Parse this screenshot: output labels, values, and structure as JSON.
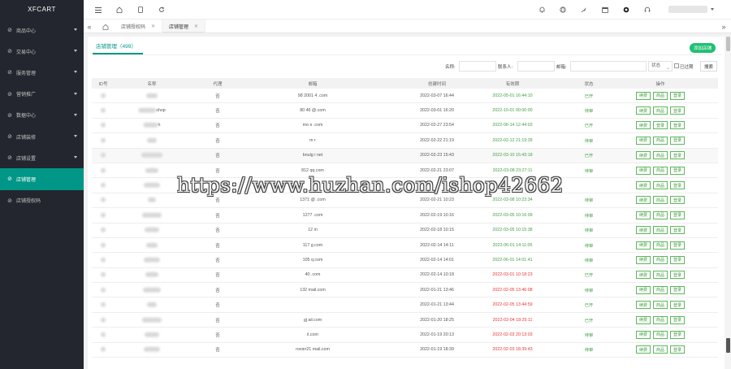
{
  "sidebar": {
    "brand": "XFCART",
    "items": [
      {
        "label": "商品中心",
        "icon": "grid-icon",
        "has_arrow": true
      },
      {
        "label": "交易中心",
        "icon": "cart-icon",
        "has_arrow": true
      },
      {
        "label": "服务管理",
        "icon": "briefcase-icon",
        "has_arrow": true
      },
      {
        "label": "营销推广",
        "icon": "megaphone-icon",
        "has_arrow": true
      },
      {
        "label": "数据中心",
        "icon": "chart-icon",
        "has_arrow": true
      },
      {
        "label": "店铺装修",
        "icon": "brush-icon",
        "has_arrow": true
      },
      {
        "label": "店铺设置",
        "icon": "gear-icon",
        "has_arrow": true
      },
      {
        "label": "店铺管理",
        "icon": "shop-icon",
        "has_arrow": false,
        "active": true
      },
      {
        "label": "店铺授权码",
        "icon": "key-icon",
        "has_arrow": false
      }
    ]
  },
  "header": {
    "icons": [
      "menu-icon",
      "home-icon",
      "mobile-icon",
      "refresh-icon"
    ],
    "right_icons": [
      "bell-icon",
      "globe-icon",
      "rocket-icon",
      "calendar-icon",
      "theme-icon",
      "headset-icon"
    ]
  },
  "tabs": [
    {
      "label": "店铺授权码",
      "active": false
    },
    {
      "label": "店铺管理",
      "active": true
    }
  ],
  "content": {
    "tab_label": "店铺管理（499）",
    "add_button": "添加店铺",
    "filters": {
      "name_label": "名称:",
      "contact_label": "联系人:",
      "email_label": "邮箱:",
      "status_placeholder": "状态",
      "expired_label": "已过期",
      "search_button": "搜索"
    }
  },
  "table": {
    "columns": [
      "ID号",
      "名称",
      "代理",
      "邮箱",
      "创建时间",
      "有效期",
      "状态",
      "操作"
    ],
    "ops": [
      "续费",
      "商品",
      "登录"
    ],
    "rows": [
      {
        "id": "",
        "name": "",
        "agent": "否",
        "email": "98  2001  4  .com",
        "created": "2022-03-07 16:44",
        "expire": "2022-05-01 16:44:10",
        "expire_color": "green",
        "status": "已开",
        "ops": [
          "续费",
          "商品",
          "登录"
        ]
      },
      {
        "id": "",
        "name": "shop",
        "agent": "否",
        "email": "80  46  @.com",
        "created": "2022-03-01 16:20",
        "expire": "2022-10-01 00:00:00",
        "expire_color": "green",
        "status": "待审",
        "ops": [
          "续费",
          "商品",
          "登录"
        ]
      },
      {
        "id": "",
        "name": "h",
        "agent": "否",
        "email": "mo  e  .com",
        "created": "2022-02-27 23:54",
        "expire": "2022-06-14 12:44:03",
        "expire_color": "green",
        "status": "已开",
        "ops": [
          "续费",
          "登录",
          "登录"
        ]
      },
      {
        "id": "",
        "name": "",
        "agent": "否",
        "email": "m  r",
        "created": "2022-02-22 21:19",
        "expire": "2022-02-12 21:19:39",
        "expire_color": "green",
        "status": "待审",
        "ops": [
          "续费",
          "商品",
          "登录"
        ]
      },
      {
        "id": "",
        "name": "",
        "agent": "否",
        "email": "bnulg  i  net",
        "created": "2022-02-23 15:43",
        "expire": "2022-03-10 15:43:18",
        "expire_color": "green",
        "status": "已开",
        "ops": [
          "续费",
          "商品",
          "登录"
        ]
      },
      {
        "id": "",
        "name": "",
        "agent": "否",
        "email": "812  qq.com",
        "created": "2022-02-21 23:07",
        "expire": "2022-03-08 23:27:11",
        "expire_color": "green",
        "status": "待审",
        "ops": [
          "续费",
          "商品",
          "登录"
        ]
      },
      {
        "id": "",
        "name": "",
        "agent": "否",
        "email": "",
        "created": "",
        "expire": "",
        "expire_color": "green",
        "status": "",
        "ops": [
          "续费",
          "商品",
          "登录"
        ]
      },
      {
        "id": "",
        "name": "",
        "agent": "否",
        "email": "1371  @  .com",
        "created": "2022-02-21 10:23",
        "expire": "2022-03-08 10:23:34",
        "expire_color": "green",
        "status": "待审",
        "ops": [
          "续费",
          "商品",
          "登录"
        ]
      },
      {
        "id": "",
        "name": "",
        "agent": "否",
        "email": "1277  .com",
        "created": "2022-02-19 10:16",
        "expire": "2022-03-05 10:16:09",
        "expire_color": "green",
        "status": "待审",
        "ops": [
          "续费",
          "商品",
          "登录"
        ]
      },
      {
        "id": "",
        "name": "",
        "agent": "否",
        "email": "12  m",
        "created": "2022-02-18 10:15",
        "expire": "2022-03-05 10:15:38",
        "expire_color": "green",
        "status": "待审",
        "ops": [
          "续费",
          "商品",
          "登录"
        ]
      },
      {
        "id": "",
        "name": "",
        "agent": "否",
        "email": "117  g.com",
        "created": "2022-02-14 14:11",
        "expire": "2022-06-01 14:11:05",
        "expire_color": "green",
        "status": "待审",
        "ops": [
          "续费",
          "商品",
          "登录"
        ]
      },
      {
        "id": "",
        "name": "",
        "agent": "否",
        "email": "105  q.com",
        "created": "2022-02-14 14:01",
        "expire": "2022-06-01 14:01:41",
        "expire_color": "green",
        "status": "待审",
        "ops": [
          "续费",
          "商品",
          "登录"
        ]
      },
      {
        "id": "",
        "name": "",
        "agent": "否",
        "email": "40  .com",
        "created": "2022-02-14 10:18",
        "expire": "2022-03-01 10:18:23",
        "expire_color": "red",
        "status": "已开",
        "ops": [
          "续费",
          "商品",
          "登录"
        ]
      },
      {
        "id": "",
        "name": "",
        "agent": "否",
        "email": "132  mail.com",
        "created": "2022-01-21 13:46",
        "expire": "2022-02-05 13:46:08",
        "expire_color": "red",
        "status": "待审",
        "ops": [
          "续费",
          "商品",
          "登录"
        ]
      },
      {
        "id": "",
        "name": "",
        "agent": "否",
        "email": "",
        "created": "2022-01-21 13:44",
        "expire": "2022-02-05 13:44:59",
        "expire_color": "red",
        "status": "已开",
        "ops": [
          "续费",
          "商品",
          "登录"
        ]
      },
      {
        "id": "",
        "name": "",
        "agent": "否",
        "email": "gj  ail.com",
        "created": "2022-01-20 18:25",
        "expire": "2022-02-04 18:25:11",
        "expire_color": "red",
        "status": "已开",
        "ops": [
          "续费",
          "商品",
          "登录"
        ]
      },
      {
        "id": "",
        "name": "",
        "agent": "否",
        "email": "  il.com",
        "created": "2022-01-19 20:13",
        "expire": "2022-02-03 20:13:03",
        "expire_color": "red",
        "status": "待审",
        "ops": [
          "续费",
          "商品",
          "登录"
        ]
      },
      {
        "id": "",
        "name": "",
        "agent": "否",
        "email": "rovier21  mail.com",
        "created": "2022-01-19 18:39",
        "expire": "2022-02-03 18:39:43",
        "expire_color": "red",
        "status": "待审",
        "ops": [
          "续费",
          "商品",
          "登录"
        ]
      }
    ]
  },
  "watermark": "https://www.huzhan.com/ishop42662",
  "colors": {
    "sidebar_bg": "#23262e",
    "accent": "#009688",
    "add_button": "#1fbf73",
    "expire_ok": "#43a047",
    "expire_bad": "#e53935"
  }
}
